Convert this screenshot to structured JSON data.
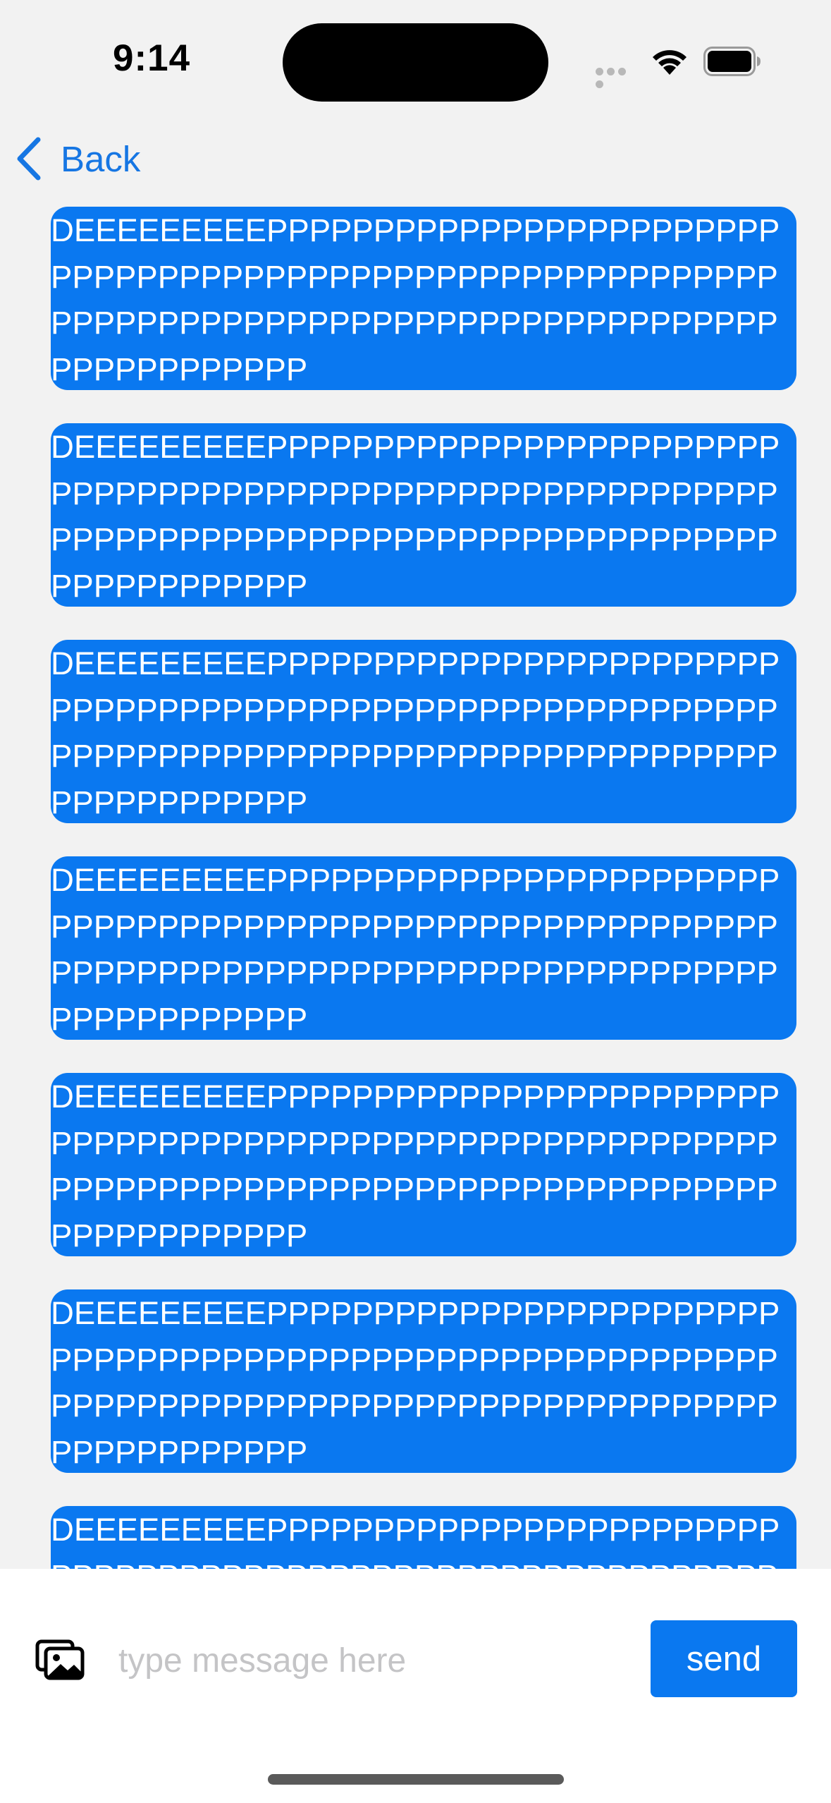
{
  "status_bar": {
    "time": "9:14"
  },
  "nav": {
    "back_label": "Back",
    "back_icon": "chevron-left-icon"
  },
  "messages": [
    {
      "text": "DEEEEEEEEEPPPPPPPPPPPPPPPPPPPPPPPPPPPPPPPPPPPPPPPPPPPPPPPPPPPPPPPPPPPPPPPPPPPPPPPPPPPPPPPPPPPPPPPPPPPPPPPPPPPPPPPP"
    },
    {
      "text": "DEEEEEEEEEPPPPPPPPPPPPPPPPPPPPPPPPPPPPPPPPPPPPPPPPPPPPPPPPPPPPPPPPPPPPPPPPPPPPPPPPPPPPPPPPPPPPPPPPPPPPPPPPPPPPPPPP"
    },
    {
      "text": "DEEEEEEEEEPPPPPPPPPPPPPPPPPPPPPPPPPPPPPPPPPPPPPPPPPPPPPPPPPPPPPPPPPPPPPPPPPPPPPPPPPPPPPPPPPPPPPPPPPPPPPPPPPPPPPPPP"
    },
    {
      "text": "DEEEEEEEEEPPPPPPPPPPPPPPPPPPPPPPPPPPPPPPPPPPPPPPPPPPPPPPPPPPPPPPPPPPPPPPPPPPPPPPPPPPPPPPPPPPPPPPPPPPPPPPPPPPPPPPPP"
    },
    {
      "text": "DEEEEEEEEEPPPPPPPPPPPPPPPPPPPPPPPPPPPPPPPPPPPPPPPPPPPPPPPPPPPPPPPPPPPPPPPPPPPPPPPPPPPPPPPPPPPPPPPPPPPPPPPPPPPPPPPP"
    },
    {
      "text": "DEEEEEEEEEPPPPPPPPPPPPPPPPPPPPPPPPPPPPPPPPPPPPPPPPPPPPPPPPPPPPPPPPPPPPPPPPPPPPPPPPPPPPPPPPPPPPPPPPPPPPPPPPPPPPPPPP"
    },
    {
      "text": "DEEEEEEEEEPPPPPPPPPPPPPPPPPPPPPPPPPPPPPPPPPPPPPPPPPPPPPPPPPPPPPPPPPPPPPPPPPPPPPPPPPPPPPPPPPPPPPPPPPPPPPPPPPPPPPPPP"
    }
  ],
  "composer": {
    "attach_icon": "photo-gallery-icon",
    "placeholder": "type message here",
    "value": "",
    "send_label": "send"
  },
  "colors": {
    "accent": "#0a78f0",
    "background": "#f2f2f2"
  }
}
